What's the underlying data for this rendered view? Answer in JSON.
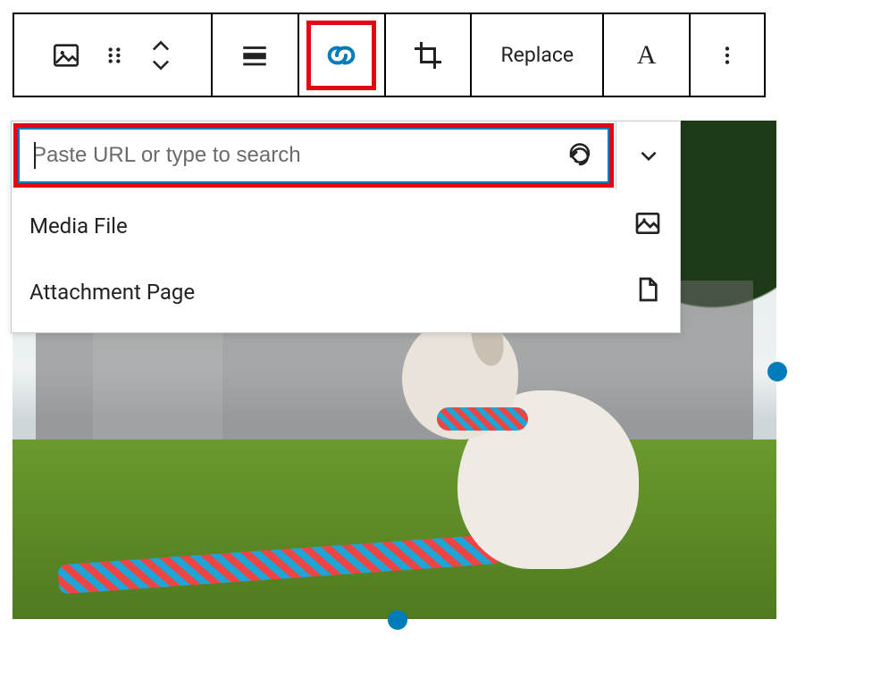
{
  "toolbar": {
    "replace_label": "Replace",
    "text_tool_label": "A"
  },
  "link_popover": {
    "placeholder": "Paste URL or type to search",
    "value": "",
    "options": [
      {
        "label": "Media File",
        "icon": "image-icon"
      },
      {
        "label": "Attachment Page",
        "icon": "page-icon"
      }
    ]
  },
  "colors": {
    "accent": "#007cba",
    "highlight": "#e30613"
  }
}
